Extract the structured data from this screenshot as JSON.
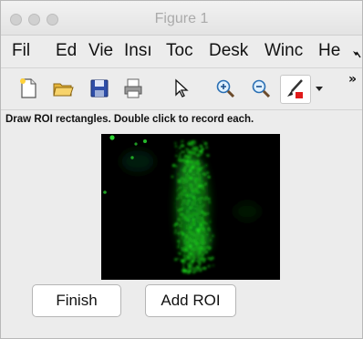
{
  "window": {
    "title": "Figure 1"
  },
  "menubar": {
    "items": [
      "Fil",
      "Ed",
      "Vie",
      "Insı",
      "Toc",
      "Desk",
      "Winc",
      "He"
    ],
    "overflow_icon": "overflow-arrow-icon"
  },
  "toolbar": {
    "icons": [
      "new-figure-icon",
      "open-file-icon",
      "save-icon",
      "print-icon",
      "pointer-icon",
      "zoom-in-icon",
      "zoom-out-icon",
      "brush-icon",
      "dropdown-arrow-icon",
      "overflow-chevron-icon"
    ],
    "overflow_label": "»"
  },
  "instruction": "Draw ROI rectangles. Double click to record each.",
  "image": {
    "description_colors": {
      "background": "#000000",
      "signal": "#22c22a"
    }
  },
  "buttons": {
    "finish": "Finish",
    "add_roi": "Add ROI"
  }
}
